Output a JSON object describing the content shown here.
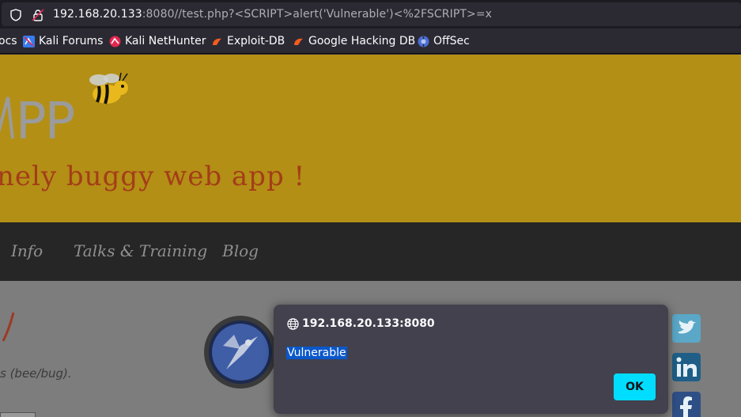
{
  "browser": {
    "url_host": "192.168.20.133",
    "url_rest": ":8080//test.php?<SCRIPT>alert('Vulnerable')<%2FSCRIPT>=x",
    "bookmarks": [
      {
        "label": "ocs",
        "icon": "none"
      },
      {
        "label": "Kali Forums",
        "icon": "kali-forums-icon"
      },
      {
        "label": "Kali NetHunter",
        "icon": "kali-nethunter-icon"
      },
      {
        "label": "Exploit-DB",
        "icon": "exploit-db-icon"
      },
      {
        "label": "Google Hacking DB",
        "icon": "google-hacking-db-icon"
      },
      {
        "label": "OffSec",
        "icon": "offsec-icon"
      }
    ]
  },
  "page": {
    "logo_partial": "PP",
    "tagline_partial": "nely buggy web app !",
    "nav": [
      "Info",
      "Talks & Training",
      "Blog"
    ],
    "bee_bug_text": "s (bee/bug).",
    "colors": {
      "header": "#b38f15",
      "tagline": "#a33d19",
      "nav": "#262626"
    }
  },
  "dialog": {
    "origin": "192.168.20.133:8080",
    "message": "Vulnerable",
    "ok_label": "OK",
    "accent": "#00ddff"
  }
}
